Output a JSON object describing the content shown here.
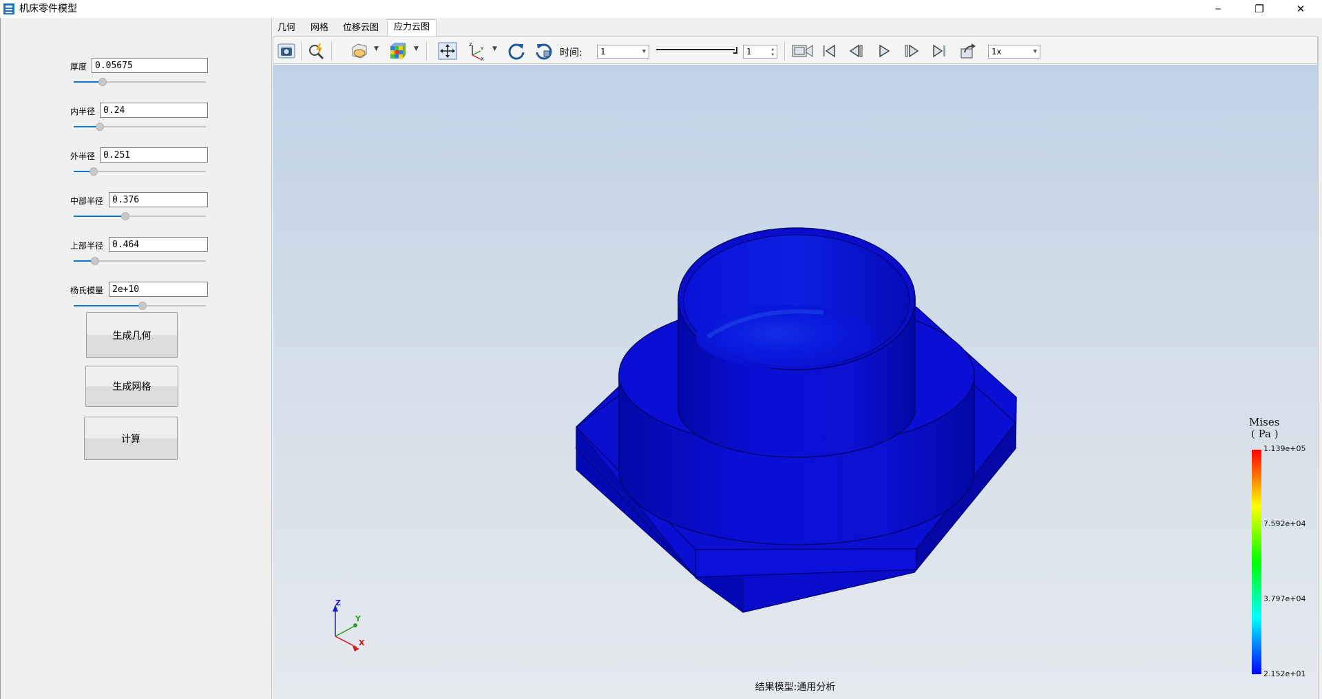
{
  "window": {
    "title": "机床零件模型",
    "minimize_symbol": "─",
    "maximize_symbol": "❐",
    "close_symbol": "✕"
  },
  "params": [
    {
      "label": "厚度",
      "value": "0.05675",
      "slider_fraction": 0.22
    },
    {
      "label": "内半径",
      "value": "0.24",
      "slider_fraction": 0.2
    },
    {
      "label": "外半径",
      "value": "0.251",
      "slider_fraction": 0.15
    },
    {
      "label": "中部半径",
      "value": "0.376",
      "slider_fraction": 0.39
    },
    {
      "label": "上部半径",
      "value": "0.464",
      "slider_fraction": 0.16
    },
    {
      "label": "杨氏模量",
      "value": "2e+10",
      "slider_fraction": 0.52
    }
  ],
  "buttons": {
    "generate_geometry": "生成几何",
    "generate_mesh": "生成网格",
    "compute": "计算"
  },
  "tabs": [
    {
      "label": "几何",
      "active": false
    },
    {
      "label": "网格",
      "active": false
    },
    {
      "label": "位移云图",
      "active": false
    },
    {
      "label": "应力云图",
      "active": true
    }
  ],
  "toolbar": {
    "time_label": "时间:",
    "time_value": "1",
    "frame_value": "1",
    "speed_value": "1x",
    "icons": [
      "camera-icon",
      "zoom-fit-icon",
      "display-style-icon",
      "colormap-icon",
      "pan-icon",
      "axes-view-icon",
      "rotate-icon",
      "rotate-reverse-icon",
      "record-video-icon",
      "first-frame-icon",
      "prev-frame-icon",
      "play-icon",
      "next-frame-icon",
      "last-frame-icon",
      "export-icon"
    ]
  },
  "viewport": {
    "status_text": "结果模型:通用分析",
    "axes": {
      "x": "X",
      "y": "Y",
      "z": "Z"
    },
    "model_color": "#0a10d8"
  },
  "legend": {
    "title_line1": "Mises",
    "title_line2": "( Pa )",
    "ticks": [
      "1.139e+05",
      "7.592e+04",
      "3.797e+04",
      "2.152e+01"
    ],
    "max": 113900,
    "min": 21.52,
    "colors": [
      "#ff0000",
      "#ffff00",
      "#00ff00",
      "#00ffff",
      "#0000ff"
    ]
  }
}
